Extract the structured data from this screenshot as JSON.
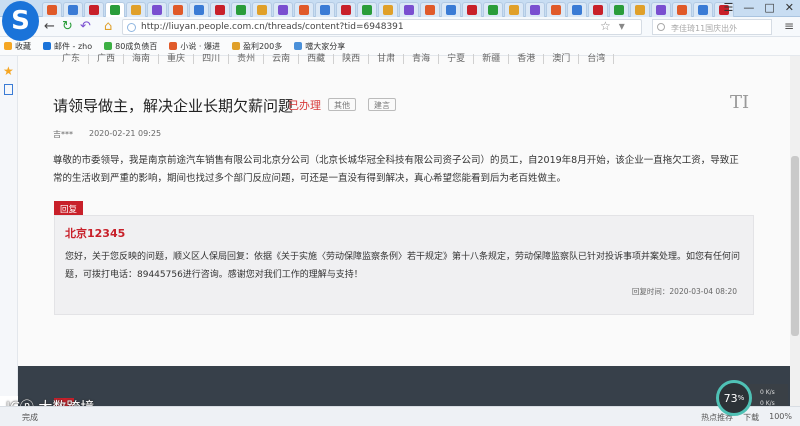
{
  "browser": {
    "logo_letter": "S",
    "tabs_count": 33,
    "url": "http://liuyan.people.com.cn/threads/content?tid=6948391",
    "search_placeholder": "李佳琦11国庆出外",
    "window_controls": [
      "☰",
      "—",
      "□",
      "✕"
    ]
  },
  "bookmarks": [
    {
      "label": "收藏",
      "color": "#f5a623"
    },
    {
      "label": "邮件 - zho",
      "color": "#1a73d9"
    },
    {
      "label": "80成负债百",
      "color": "#3cb043"
    },
    {
      "label": "小说 · 爆进",
      "color": "#e05a2a"
    },
    {
      "label": "盈利200多",
      "color": "#e0a02a"
    },
    {
      "label": "噹大家分享",
      "color": "#4a90d9"
    }
  ],
  "regions": [
    "广东",
    "广西",
    "海南",
    "重庆",
    "四川",
    "贵州",
    "云南",
    "西藏",
    "陕西",
    "甘肃",
    "青海",
    "宁夏",
    "新疆",
    "香港",
    "澳门",
    "台湾"
  ],
  "thread": {
    "title": "请领导做主，解决企业长期欠薪问题",
    "status": "已办理",
    "tags": [
      "其他",
      "建言"
    ],
    "author": "吉***",
    "posted_at": "2020-02-21 09:25",
    "body": "尊敬的市委领导，我是南京前途汽车销售有限公司北京分公司（北京长城华冠全科技有限公司资子公司）的员工，自2019年8月开始，该企业一直拖欠工资，导致正常的生活收到严重的影响，期间也找过多个部门反应问题，可还是一直没有得到解决，真心希望您能看到后为老百姓做主。"
  },
  "reply": {
    "badge": "回复",
    "org": "北京12345",
    "text": "您好，关于您反映的问题，顺义区人保局回复：依据《关于实施〈劳动保障监察条例〉若干规定》第十八条规定，劳动保障监察队已针对投诉事项并案处理。如您有任何问题，可拨打电话：89445756进行咨询。感谢您对我们工作的理解与支持！",
    "time": "回复时间：2020-03-04 08:20"
  },
  "font_tool": "TI",
  "watermark": "ICⓟ 大数跨境",
  "speed_widget": {
    "value": "73",
    "unit": "%",
    "down": "0 K/s",
    "up": "0 K/s"
  },
  "statusbar": {
    "left": "完成",
    "right": [
      "热点推荐",
      "下载",
      "100%"
    ]
  }
}
